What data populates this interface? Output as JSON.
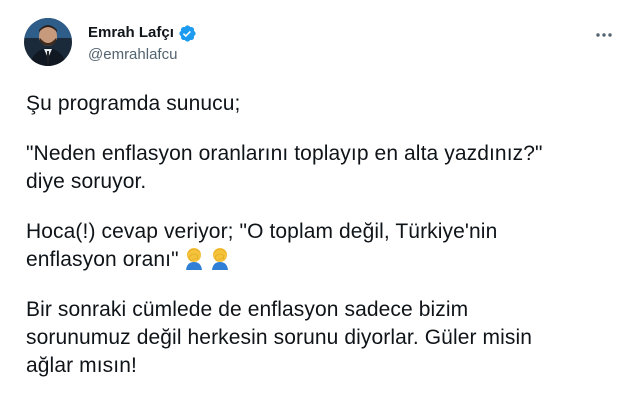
{
  "author": {
    "display_name": "Emrah Lafçı",
    "handle": "@emrahlafcu"
  },
  "icons": {
    "verified": "verified-badge-icon",
    "more": "more-options-icon",
    "emoji": "man-facepalming-emoji"
  },
  "colors": {
    "text": "#0f1419",
    "secondary": "#536471",
    "verified": "#1d9bf0"
  },
  "tweet": {
    "line1": "Şu programda sunucu;",
    "line2": "\"Neden enflasyon oranlarını toplayıp en alta yazdınız?\"",
    "line3": "diye soruyor.",
    "line4": "Hoca(!) cevap veriyor; \"O toplam değil, Türkiye'nin",
    "line5": "enflasyon oranı\"",
    "line6": "Bir sonraki cümlede de enflasyon sadece bizim",
    "line7": "sorunumuz değil herkesin sorunu diyorlar. Güler misin",
    "line8": "ağlar mısın!"
  }
}
